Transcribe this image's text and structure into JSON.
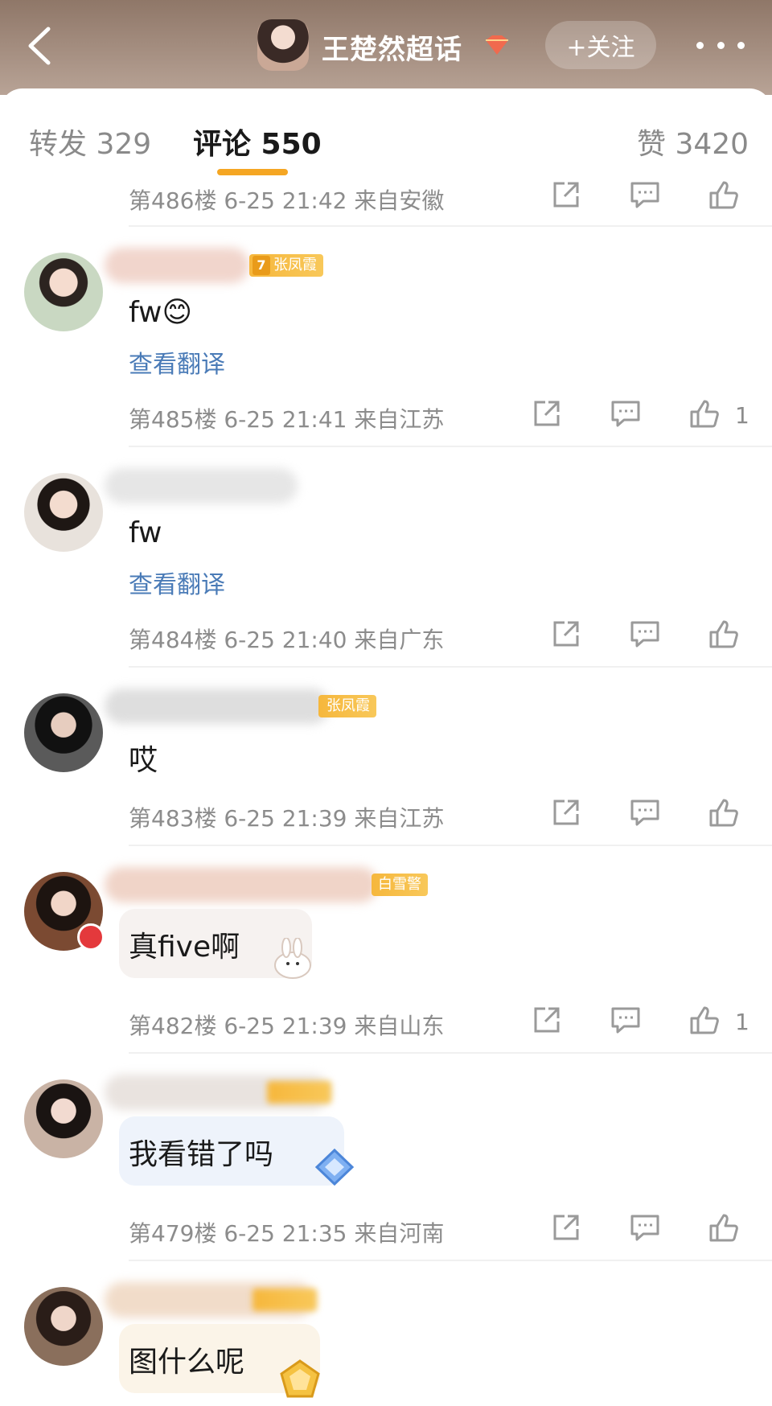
{
  "header": {
    "topic_title": "王楚然超话",
    "follow_label": "+关注"
  },
  "tabs": [
    {
      "label": "转发 329"
    },
    {
      "label": "评论 550"
    },
    {
      "label": "赞 3420"
    }
  ],
  "comments": [
    {
      "floor_meta": "第486楼 6-25 21:42 来自安徽"
    },
    {
      "tag_text": "张凤霞",
      "level": "7",
      "text": "fw😊",
      "translate": "查看翻译",
      "floor_meta": "第485楼 6-25 21:41 来自江苏",
      "likes": "1"
    },
    {
      "text": "fw",
      "translate": "查看翻译",
      "floor_meta": "第484楼 6-25 21:40 来自广东"
    },
    {
      "tag_text": "张凤霞",
      "text": "哎",
      "floor_meta": "第483楼 6-25 21:39 来自江苏"
    },
    {
      "tag_text": "白雪警",
      "text": "真five啊",
      "floor_meta": "第482楼 6-25 21:39 来自山东",
      "likes": "1"
    },
    {
      "text": "我看错了吗",
      "floor_meta": "第479楼 6-25 21:35 来自河南"
    },
    {
      "text": "图什么呢"
    }
  ],
  "colors": {
    "accent": "#f5a623",
    "link": "#4a7bb7",
    "meta": "#8c8c8c"
  }
}
